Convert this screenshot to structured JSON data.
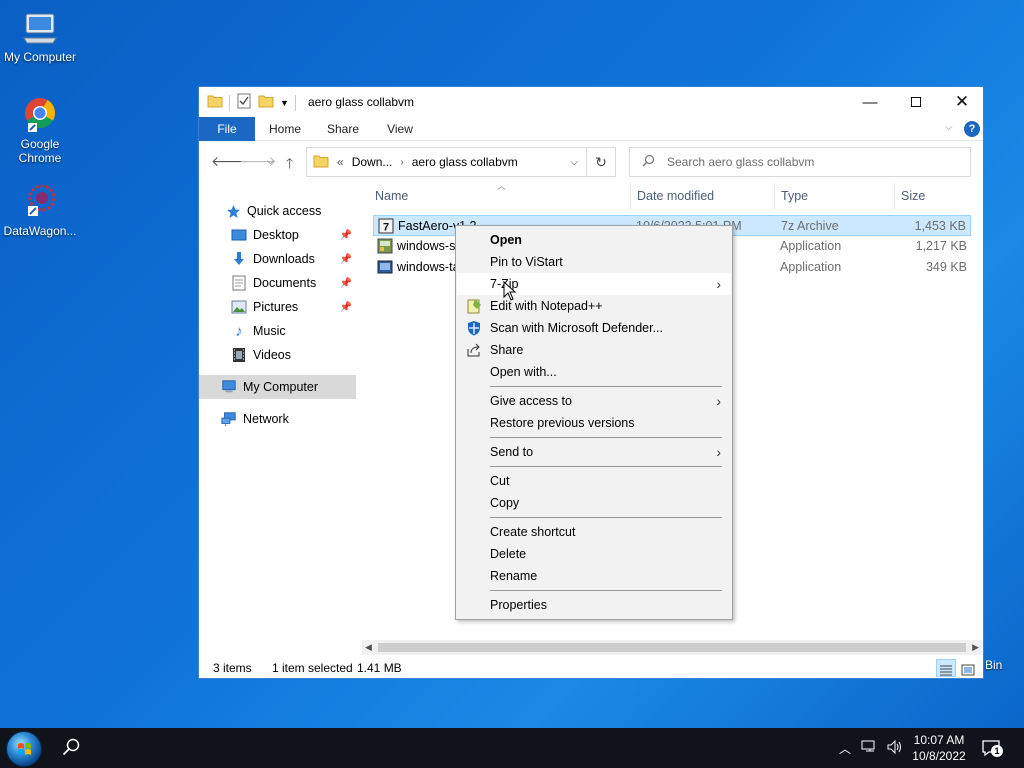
{
  "desktop": {
    "icons": [
      {
        "label": "My Computer",
        "icon": "computer-icon"
      },
      {
        "label": "Google Chrome",
        "icon": "chrome-icon"
      },
      {
        "label": "DataWagon...",
        "icon": "datawagon-icon"
      }
    ],
    "recycle_bin_partial_label": "Bin"
  },
  "window": {
    "title": "aero glass collabvm",
    "ribbon_tabs": [
      "File",
      "Home",
      "Share",
      "View"
    ],
    "breadcrumb": {
      "overflow": "«",
      "parent": "Down...",
      "current": "aero glass collabvm"
    },
    "search_placeholder": "Search aero glass collabvm",
    "nav": [
      {
        "label": "Quick access",
        "icon": "star-icon"
      },
      {
        "label": "Desktop",
        "icon": "desktop-folder-icon",
        "pinned": true
      },
      {
        "label": "Downloads",
        "icon": "download-icon",
        "pinned": true
      },
      {
        "label": "Documents",
        "icon": "documents-icon",
        "pinned": true
      },
      {
        "label": "Pictures",
        "icon": "pictures-icon",
        "pinned": true
      },
      {
        "label": "Music",
        "icon": "music-icon"
      },
      {
        "label": "Videos",
        "icon": "videos-icon"
      },
      {
        "label": "My Computer",
        "icon": "computer-icon",
        "selected": true
      },
      {
        "label": "Network",
        "icon": "network-icon"
      }
    ],
    "columns": [
      "Name",
      "Date modified",
      "Type",
      "Size"
    ],
    "files": [
      {
        "name": "FastAero-v1.2",
        "date": "10/6/2022 5:01 PM",
        "type": "7z Archive",
        "size": "1,453 KB",
        "selected": true
      },
      {
        "name": "windows-st",
        "date": "",
        "type": "Application",
        "size": "1,217 KB"
      },
      {
        "name": "windows-ta",
        "date": "",
        "type": "Application",
        "size": "349 KB"
      }
    ],
    "status": {
      "count": "3 items",
      "selection": "1 item selected",
      "size": "1.41 MB"
    }
  },
  "context_menu": [
    {
      "label": "Open",
      "bold": true
    },
    {
      "label": "Pin to ViStart"
    },
    {
      "label": "7-Zip",
      "submenu": true,
      "hover": true
    },
    {
      "label": "Edit with Notepad++",
      "icon": "notepadpp-icon"
    },
    {
      "label": "Scan with Microsoft Defender...",
      "icon": "defender-icon"
    },
    {
      "label": "Share",
      "icon": "share-icon"
    },
    {
      "label": "Open with..."
    },
    {
      "label": "Give access to",
      "submenu": true
    },
    {
      "label": "Restore previous versions"
    },
    {
      "label": "Send to",
      "submenu": true
    },
    {
      "label": "Cut"
    },
    {
      "label": "Copy"
    },
    {
      "label": "Create shortcut"
    },
    {
      "label": "Delete"
    },
    {
      "label": "Rename"
    },
    {
      "label": "Properties"
    }
  ],
  "taskbar": {
    "time": "10:07 AM",
    "date": "10/8/2022",
    "notification_count": "1"
  },
  "colors": {
    "accent": "#1b67c4",
    "selection": "#cce8ff",
    "desktop": "#0f74d9"
  }
}
